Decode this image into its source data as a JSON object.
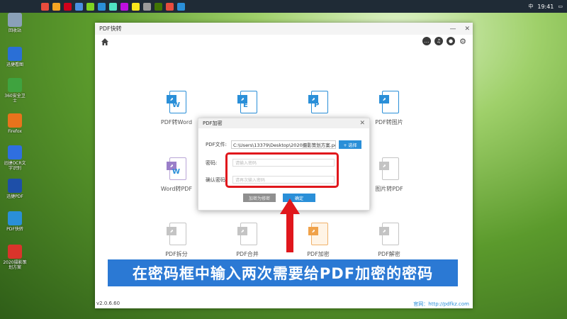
{
  "window": {
    "title": "PDF快转",
    "version": "v2.0.6.60",
    "site_label": "官网：",
    "site_url": "http://pdfkz.com"
  },
  "tiles": [
    {
      "label": "PDF转Word",
      "letter": "W"
    },
    {
      "label": "",
      "letter": "E"
    },
    {
      "label": "",
      "letter": "P"
    },
    {
      "label": "PDF转图片",
      "letter": ""
    },
    {
      "label": "Word转PDF",
      "letter": "W"
    },
    {
      "label": "图片转PDF",
      "letter": ""
    },
    {
      "label": "PDF拆分",
      "letter": ""
    },
    {
      "label": "PDF合并",
      "letter": ""
    },
    {
      "label": "PDF加密",
      "letter": ""
    },
    {
      "label": "PDF解密",
      "letter": ""
    }
  ],
  "dialog": {
    "title": "PDF加密",
    "file_label": "PDF文件:",
    "file_path": "C:\\Users\\13379\\Desktop\\2020摄影策划方案.pdf",
    "choose_label": "+ 选择",
    "password_label": "密码:",
    "password_placeholder": "请输入密码",
    "confirm_label": "确认密码:",
    "confirm_placeholder": "请再次输入密码",
    "cancel_label": "加密为修密",
    "ok_label": "确定"
  },
  "caption": "在密码框中输入两次需要给PDF加密的密码",
  "taskbar": {
    "time": "19:41",
    "ime": "中"
  },
  "desktop": [
    {
      "label": "回收站",
      "color": "#8aa0b8"
    },
    {
      "label": "迅捷看图",
      "color": "#2a6fd6"
    },
    {
      "label": "360安全卫士",
      "color": "#3fa33f"
    },
    {
      "label": "Firefox",
      "color": "#e8731c"
    },
    {
      "label": "迅捷OCR文字识别",
      "color": "#2f6fe0"
    },
    {
      "label": "迅捷PDF",
      "color": "#1e4fa8"
    },
    {
      "label": "PDF快转",
      "color": "#2a8fd8"
    },
    {
      "label": "2020摄影策划方案",
      "color": "#d9342b"
    }
  ]
}
